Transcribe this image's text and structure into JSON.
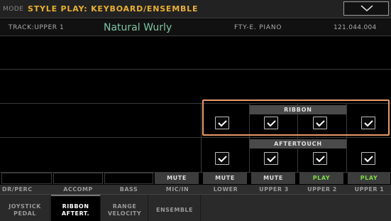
{
  "header": {
    "mode_label": "MODE",
    "mode_title": "STYLE PLAY: KEYBOARD/ENSEMBLE",
    "menu_icon": "chevron-down-icon"
  },
  "track": {
    "label": "TRACK:UPPER 1",
    "sound_name": "Natural Wurly",
    "category": "FTY-E. PIANO",
    "number": "121.044.004"
  },
  "groups": {
    "ribbon": "RIBBON",
    "aftertouch": "AFTERTOUCH"
  },
  "ribbon_checks": {
    "lower": true,
    "upper3": true,
    "upper2": true,
    "upper1": true
  },
  "aftertouch_checks": {
    "lower": true,
    "upper3": true,
    "upper2": true,
    "upper1": true
  },
  "buttons": {
    "mic_in": "MUTE",
    "lower": "MUTE",
    "upper3": "MUTE",
    "upper2": "PLAY",
    "upper1": "PLAY"
  },
  "track_labels": {
    "dr_perc": "DR/PERC",
    "accomp": "ACCOMP",
    "bass": "BASS",
    "mic_in": "MIC/IN",
    "lower": "LOWER",
    "upper3": "UPPER 3",
    "upper2": "UPPER 2",
    "upper1": "UPPER 1"
  },
  "tabs": {
    "joystick_l1": "JOYSTICK",
    "joystick_l2": "PEDAL",
    "ribbon_l1": "RIBBON",
    "ribbon_l2": "AFTERT.",
    "range_l1": "RANGE",
    "range_l2": "VELOCITY",
    "ensemble": "ENSEMBLE"
  },
  "colors": {
    "mode_title": "#e8b030",
    "sound_name": "#7fc4a0",
    "highlight": "#e89a68",
    "play": "#7cd94a"
  }
}
